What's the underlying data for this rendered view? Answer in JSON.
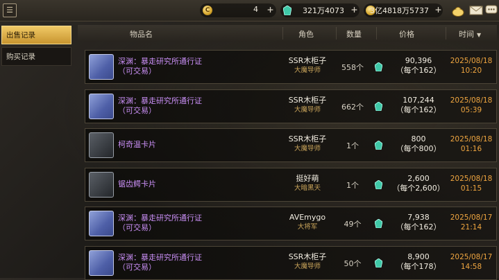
{
  "topbar": {
    "menu_icon": "document-icon",
    "currencies": [
      {
        "icon": "c-coin-icon",
        "glyph": "C",
        "value": "4"
      },
      {
        "icon": "gem-icon",
        "value": "321万4073"
      },
      {
        "icon": "gold-coin-icon",
        "value": "3亿4818万5737"
      }
    ],
    "plus_label": "+",
    "action_icons": [
      "money-bag-icon",
      "mail-icon",
      "chat-icon"
    ]
  },
  "sidebar": {
    "tabs": [
      {
        "label": "出售记录",
        "active": true
      },
      {
        "label": "购买记录",
        "active": false
      }
    ]
  },
  "table": {
    "headers": {
      "item": "物品名",
      "role": "角色",
      "qty": "数量",
      "price": "价格",
      "time": "时间",
      "sort_caret": "▼"
    },
    "rows": [
      {
        "thumb": "ticket",
        "name": "深渊：暴走研究所通行证（可交易）",
        "role": "SSR木柜子",
        "job": "大魔导师",
        "qty": "558个",
        "price": "90,396",
        "unit": "（每个162）",
        "date": "2025/08/18",
        "clock": "10:20"
      },
      {
        "thumb": "ticket",
        "name": "深渊：暴走研究所通行证（可交易）",
        "role": "SSR木柜子",
        "job": "大魔导师",
        "qty": "662个",
        "price": "107,244",
        "unit": "（每个162）",
        "date": "2025/08/18",
        "clock": "05:39"
      },
      {
        "thumb": "card",
        "name": "柯奇温卡片",
        "role": "SSR木柜子",
        "job": "大魔导师",
        "qty": "1个",
        "price": "800",
        "unit": "（每个800）",
        "date": "2025/08/18",
        "clock": "01:16"
      },
      {
        "thumb": "card",
        "name": "锯齿鳄卡片",
        "role": "挺好萌",
        "job": "大暗黑天",
        "qty": "1个",
        "price": "2,600",
        "unit": "（每个2,600）",
        "date": "2025/08/18",
        "clock": "01:15"
      },
      {
        "thumb": "ticket",
        "name": "深渊：暴走研究所通行证（可交易）",
        "role": "AVEmygo",
        "job": "大将军",
        "qty": "49个",
        "price": "7,938",
        "unit": "（每个162）",
        "date": "2025/08/17",
        "clock": "21:14"
      },
      {
        "thumb": "ticket",
        "name": "深渊：暴走研究所通行证（可交易）",
        "role": "SSR木柜子",
        "job": "大魔导师",
        "qty": "50个",
        "price": "8,900",
        "unit": "（每个178）",
        "date": "2025/08/17",
        "clock": "14:58"
      }
    ]
  },
  "colors": {
    "accent_gold": "#f0c967",
    "item_purple": "#c88ef4",
    "time_orange": "#f0a640",
    "job_gold": "#c9a45a"
  }
}
